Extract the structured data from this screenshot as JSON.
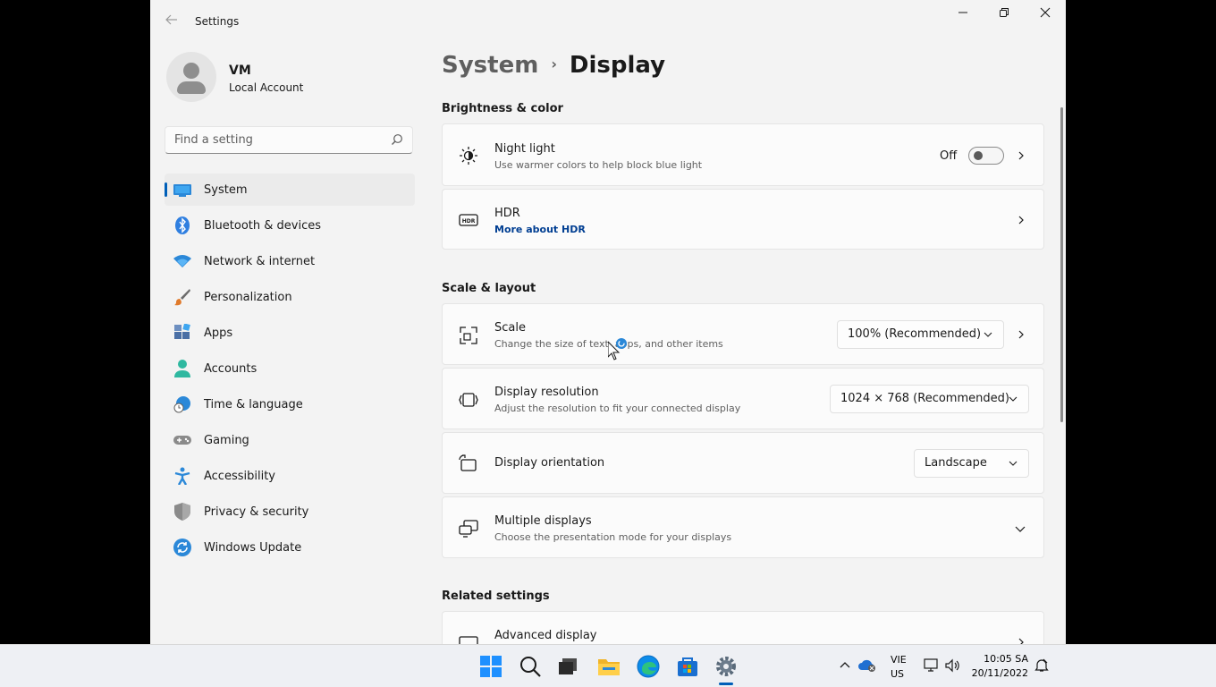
{
  "window": {
    "title": "Settings",
    "back_icon": "arrow-left-icon",
    "controls": [
      "minimize-icon",
      "restore-icon",
      "close-icon"
    ]
  },
  "profile": {
    "name": "VM",
    "account_type": "Local Account"
  },
  "search": {
    "placeholder": "Find a setting"
  },
  "sidebar": {
    "items": [
      {
        "label": "System",
        "icon": "system-icon",
        "active": true
      },
      {
        "label": "Bluetooth & devices",
        "icon": "bluetooth-icon"
      },
      {
        "label": "Network & internet",
        "icon": "wifi-icon"
      },
      {
        "label": "Personalization",
        "icon": "brush-icon"
      },
      {
        "label": "Apps",
        "icon": "apps-icon"
      },
      {
        "label": "Accounts",
        "icon": "person-icon"
      },
      {
        "label": "Time & language",
        "icon": "globe-clock-icon"
      },
      {
        "label": "Gaming",
        "icon": "gamepad-icon"
      },
      {
        "label": "Accessibility",
        "icon": "accessibility-icon"
      },
      {
        "label": "Privacy & security",
        "icon": "shield-icon"
      },
      {
        "label": "Windows Update",
        "icon": "update-icon"
      }
    ]
  },
  "breadcrumb": {
    "parent": "System",
    "separator": "›",
    "current": "Display"
  },
  "sections": {
    "brightness": {
      "title": "Brightness & color",
      "night_light": {
        "title": "Night light",
        "subtitle": "Use warmer colors to help block blue light",
        "state": "Off"
      },
      "hdr": {
        "title": "HDR",
        "link": "More about HDR"
      }
    },
    "scale_layout": {
      "title": "Scale & layout",
      "scale": {
        "title": "Scale",
        "subtitle": "Change the size of text, apps, and other items",
        "value": "100% (Recommended)"
      },
      "resolution": {
        "title": "Display resolution",
        "subtitle": "Adjust the resolution to fit your connected display",
        "value": "1024 × 768 (Recommended)"
      },
      "orientation": {
        "title": "Display orientation",
        "value": "Landscape"
      },
      "multiple": {
        "title": "Multiple displays",
        "subtitle": "Choose the presentation mode for your displays"
      }
    },
    "related": {
      "title": "Related settings",
      "advanced": {
        "title": "Advanced display"
      }
    }
  },
  "taskbar": {
    "apps": [
      "start-icon",
      "search-icon",
      "task-view-icon",
      "file-explorer-icon",
      "edge-icon",
      "store-icon",
      "settings-icon"
    ],
    "language_line1": "VIE",
    "language_line2": "US",
    "time": "10:05 SA",
    "date": "20/11/2022"
  },
  "colors": {
    "accent": "#005fb8",
    "window_bg": "#f3f3f3",
    "card_bg": "#fbfbfb"
  }
}
